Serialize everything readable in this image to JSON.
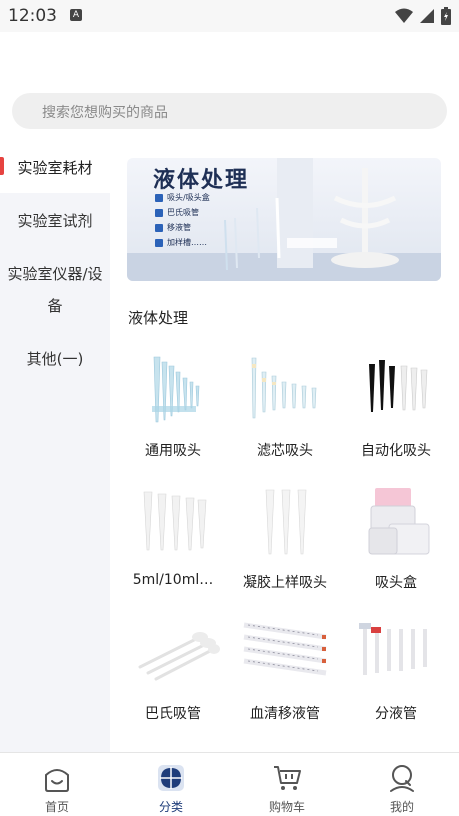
{
  "status_bar": {
    "time": "12:03",
    "notification_badge": "A"
  },
  "search": {
    "placeholder": "搜索您想购买的商品"
  },
  "sidebar": {
    "categories": [
      {
        "label": "实验室耗材",
        "active": true
      },
      {
        "label": "实验室试剂",
        "active": false
      },
      {
        "label": "实验室仪器/设备",
        "active": false
      },
      {
        "label": "其他(一)",
        "active": false
      }
    ]
  },
  "banner": {
    "title": "液体处理",
    "items": [
      "吸头/吸头盒",
      "巴氏吸管",
      "移液管",
      "加样槽……"
    ]
  },
  "section": {
    "title": "液体处理"
  },
  "products": [
    {
      "label": "通用吸头",
      "icon": "pipette-tips-icon"
    },
    {
      "label": "滤芯吸头",
      "icon": "filter-tips-icon"
    },
    {
      "label": "自动化吸头",
      "icon": "automation-tips-icon"
    },
    {
      "label": "5ml/10ml…",
      "icon": "large-tips-icon"
    },
    {
      "label": "凝胶上样吸头",
      "icon": "gel-loading-tips-icon"
    },
    {
      "label": "吸头盒",
      "icon": "tip-box-icon"
    },
    {
      "label": "巴氏吸管",
      "icon": "pasteur-pipette-icon"
    },
    {
      "label": "血清移液管",
      "icon": "serological-pipette-icon"
    },
    {
      "label": "分液管",
      "icon": "dispenser-tube-icon"
    }
  ],
  "tabbar": {
    "tabs": [
      {
        "label": "首页",
        "icon": "home-icon",
        "active": false
      },
      {
        "label": "分类",
        "icon": "category-icon",
        "active": true
      },
      {
        "label": "购物车",
        "icon": "cart-icon",
        "active": false
      },
      {
        "label": "我的",
        "icon": "profile-icon",
        "active": false
      }
    ]
  },
  "colors": {
    "accent": "#1f3d7a",
    "indicator": "#e64340",
    "sidebar_bg": "#f4f5f9"
  }
}
